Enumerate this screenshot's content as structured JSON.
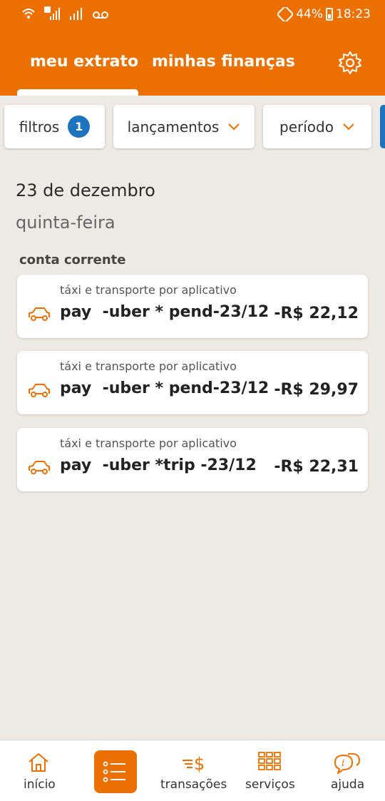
{
  "status_bar": {
    "battery": "44%",
    "time": "18:23"
  },
  "header": {
    "tabs": [
      {
        "label": "meu extrato"
      },
      {
        "label": "minhas finanças"
      }
    ]
  },
  "filters": {
    "filtros_label": "filtros",
    "filtros_count": "1",
    "lancamentos_label": "lançamentos",
    "periodo_label": "período"
  },
  "day": {
    "date": "23 de dezembro",
    "weekday": "quinta-feira",
    "account": "conta corrente"
  },
  "transactions": [
    {
      "category": "táxi e transporte por aplicativo",
      "description": "pay  -uber * pend-23/12",
      "amount": "-R$ 22,12"
    },
    {
      "category": "táxi e transporte por aplicativo",
      "description": "pay  -uber * pend-23/12",
      "amount": "-R$ 29,97"
    },
    {
      "category": "táxi e transporte por aplicativo",
      "description": "pay  -uber *trip -23/12",
      "amount": "-R$ 22,31"
    }
  ],
  "bottom_nav": [
    {
      "label": "início",
      "icon": "home-icon"
    },
    {
      "label": "",
      "icon": "list-icon"
    },
    {
      "label": "transações",
      "icon": "transfer-money-icon"
    },
    {
      "label": "serviços",
      "icon": "grid-icon"
    },
    {
      "label": "ajuda",
      "icon": "help-chat-icon"
    }
  ],
  "colors": {
    "brand": "#ec7000",
    "accent": "#1e73be",
    "background": "#ede9e5"
  }
}
